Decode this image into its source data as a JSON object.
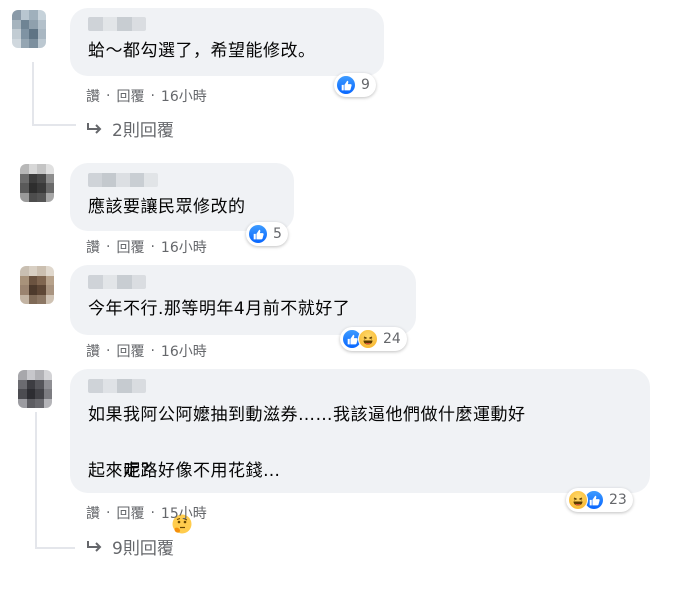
{
  "actions": {
    "like": "讚",
    "reply": "回覆",
    "dot": "·"
  },
  "colors": {
    "bubble": "#f0f2f5",
    "like_blue": "#0866ff",
    "secondary_text": "#65676b"
  },
  "comments": [
    {
      "text": "蛤～都勾選了，希望能修改。",
      "time": "16小時",
      "reactions": {
        "icons": [
          "like-icon"
        ],
        "count": "9"
      },
      "replies": "2則回覆"
    },
    {
      "text": "應該要讓民眾修改的",
      "time": "16小時",
      "reactions": {
        "icons": [
          "like-icon"
        ],
        "count": "5"
      }
    },
    {
      "text": "今年不行.那等明年4月前不就好了",
      "time": "16小時",
      "reactions": {
        "icons": [
          "like-icon",
          "haha-icon"
        ],
        "count": "24"
      }
    },
    {
      "text_line1": "如果我阿公阿嬤抽到動滋券……我該逼他們做什麼運動好",
      "text_line2": "呢？",
      "text_line3": "起來走路好像不用花錢…",
      "emoji": "thinking-face-icon",
      "time": "15小時",
      "reactions": {
        "icons": [
          "haha-icon",
          "like-icon"
        ],
        "count": "23"
      },
      "replies": "9則回覆"
    }
  ]
}
